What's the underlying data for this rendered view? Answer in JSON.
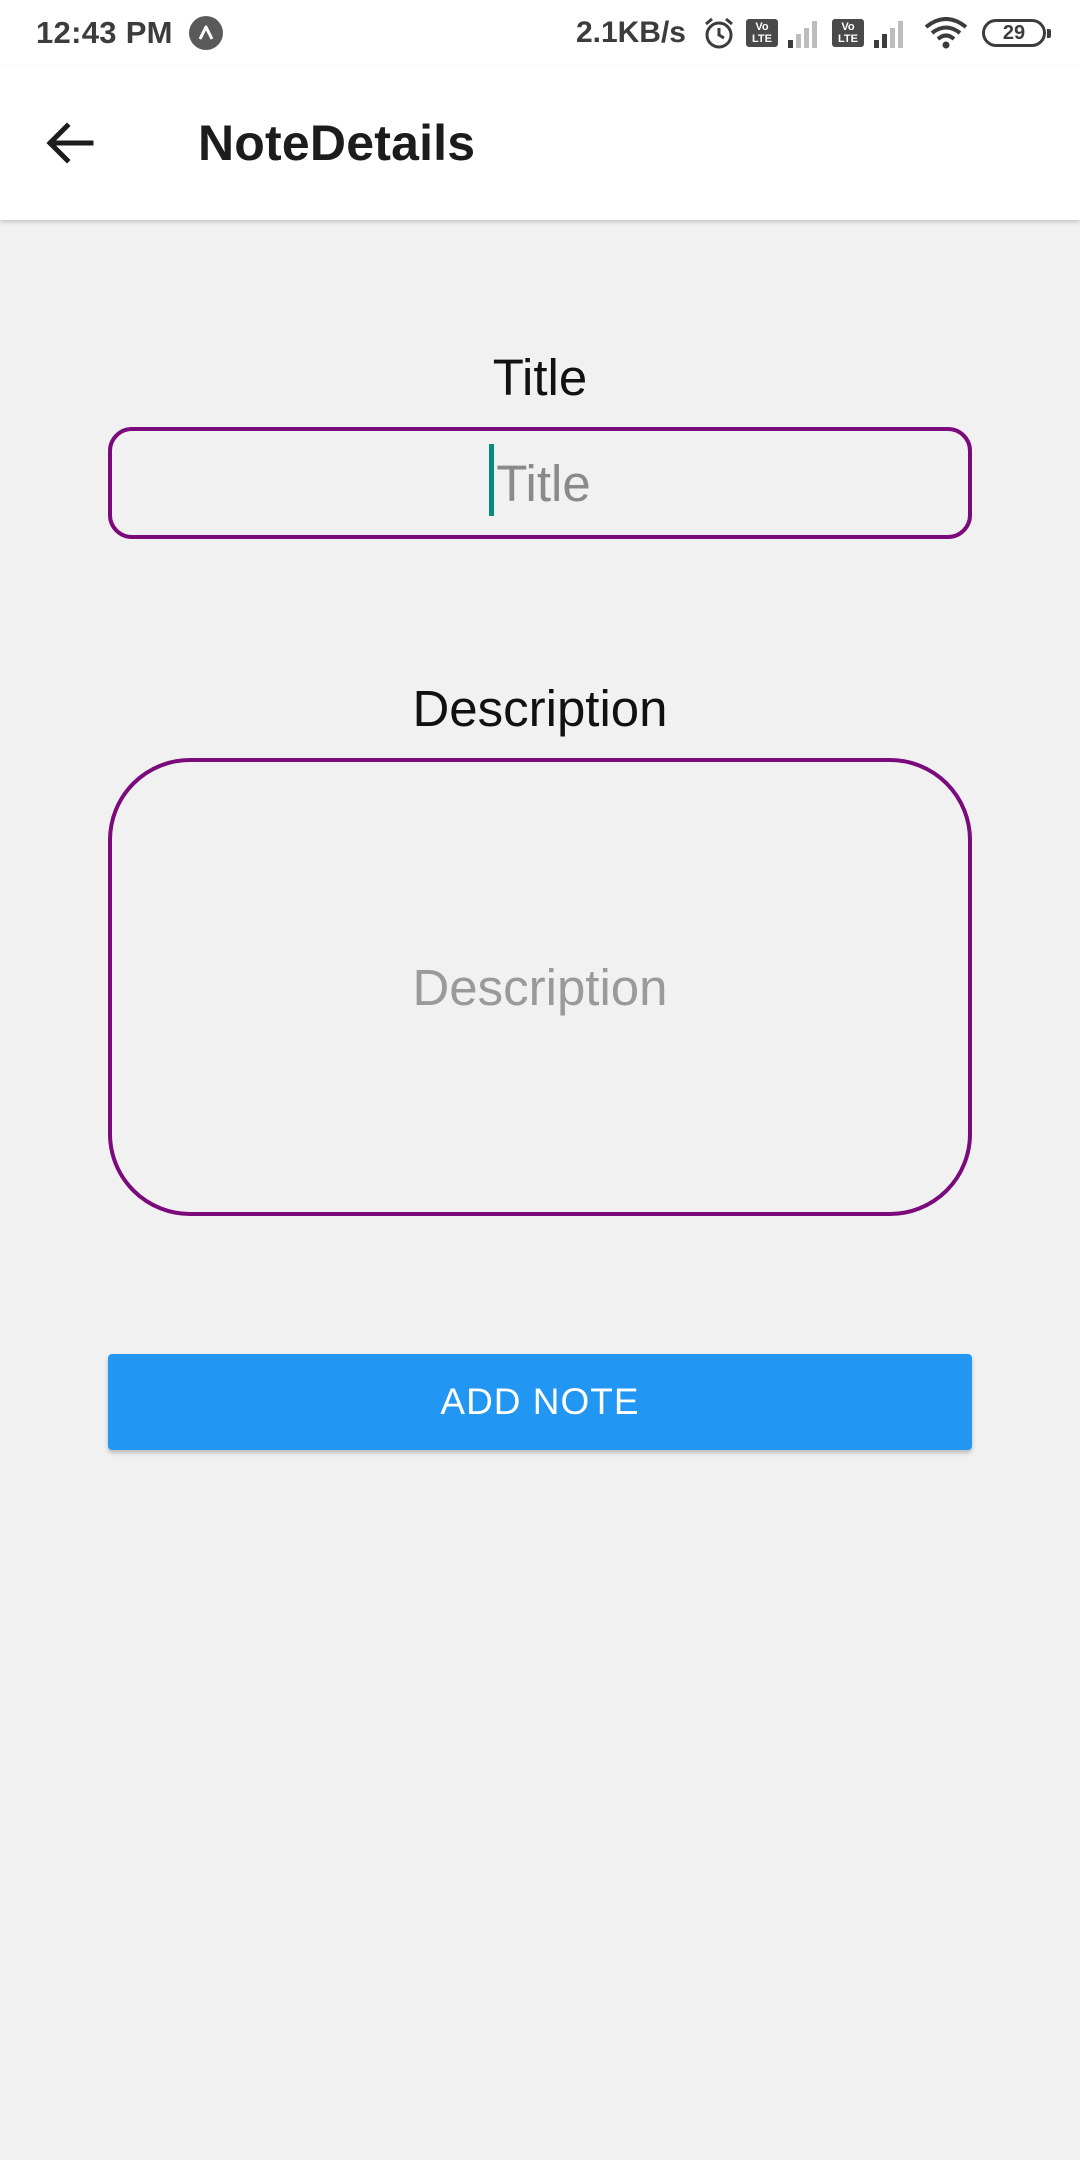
{
  "status_bar": {
    "time": "12:43 PM",
    "net_speed": "2.1KB/s",
    "volte_1": "Vo LTE",
    "volte_2": "Vo LTE",
    "battery_level": "29",
    "icons": [
      "notification-a-icon",
      "alarm-icon",
      "signal-icon",
      "wifi-icon",
      "battery-icon"
    ]
  },
  "app_bar": {
    "title": "NoteDetails",
    "back_icon": "arrow-left-icon"
  },
  "form": {
    "title_label": "Title",
    "title_placeholder": "Title",
    "description_label": "Description",
    "description_placeholder": "Description",
    "submit_label": "ADD NOTE"
  },
  "colors": {
    "accent_border": "#7b0a7c",
    "button": "#2196f3",
    "caret": "#0a8a7a",
    "background": "#f1f1f1"
  }
}
